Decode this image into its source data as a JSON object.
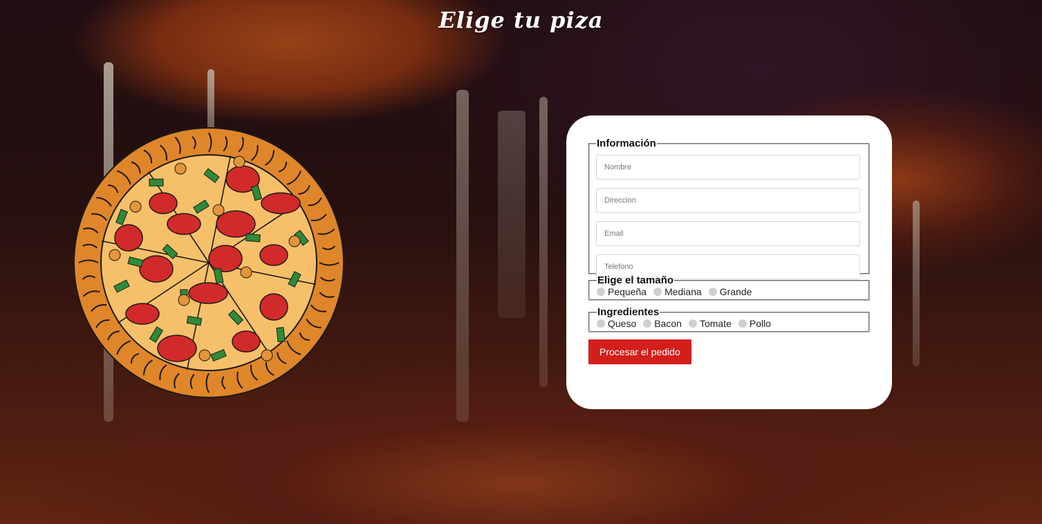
{
  "header": {
    "title": "Elige tu piza"
  },
  "form": {
    "info": {
      "legend": "Información",
      "fields": [
        {
          "name": "nombre",
          "placeholder": "Nombre",
          "value": ""
        },
        {
          "name": "direccion",
          "placeholder": "Direccion",
          "value": ""
        },
        {
          "name": "email",
          "placeholder": "Email",
          "value": ""
        },
        {
          "name": "telefono",
          "placeholder": "Telefono",
          "value": ""
        }
      ]
    },
    "size": {
      "legend": "Elige el tamaño",
      "options": [
        "Pequeña",
        "Mediana",
        "Grande"
      ]
    },
    "ingredients": {
      "legend": "Ingredientes",
      "options": [
        "Queso",
        "Bacon",
        "Tomate",
        "Pollo"
      ]
    },
    "submit_label": "Procesar el pedido"
  },
  "colors": {
    "accent": "#d21f1b",
    "card": "#ffffff",
    "crust": "#e0862a",
    "cheese": "#f6c06a",
    "pepperoni": "#d22a2a",
    "pepper": "#2f8a3a"
  },
  "icons": {
    "illustration": "pizza-illustration",
    "background": "pizza-photo-background"
  }
}
